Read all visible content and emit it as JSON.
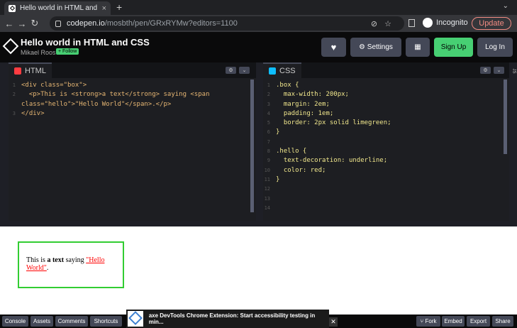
{
  "browser": {
    "tab_title": "Hello world in HTML and C",
    "tab_close": "×",
    "new_tab": "+",
    "tab_menu": "⌄",
    "url_host": "codepen.io",
    "url_path": "/mosbth/pen/GRxRYMw?editors=1100",
    "incognito_label": "Incognito",
    "update_label": "Update",
    "omni_icons": "⊘☆"
  },
  "header": {
    "title": "Hello world in HTML and CSS",
    "author": "Mikael Roos",
    "follow_label": "+ Follow",
    "heart": "♥",
    "settings_label": "⚙ Settings",
    "layout": "▦",
    "signup_label": "Sign Up",
    "login_label": "Log In"
  },
  "editors": {
    "html_tab": "HTML",
    "css_tab": "CSS",
    "ctrl_gear": "⚙",
    "ctrl_chevron": "⌄",
    "side_label": "JS"
  },
  "html_lines": [
    {
      "num": "1",
      "code": "<div class=\"box\">"
    },
    {
      "num": "2",
      "code": "  <p>This is <strong>a text</strong> saying <span"
    },
    {
      "num": "",
      "code": "class=\"hello\">\"Hello World\"</span>.</p>"
    },
    {
      "num": "3",
      "code": "</div>"
    }
  ],
  "css_lines": [
    {
      "num": "1",
      "code": ".box {"
    },
    {
      "num": "2",
      "code": "  max-width: 200px;"
    },
    {
      "num": "3",
      "code": "  margin: 2em;"
    },
    {
      "num": "4",
      "code": "  padding: 1em;"
    },
    {
      "num": "5",
      "code": "  border: 2px solid limegreen;"
    },
    {
      "num": "6",
      "code": "}"
    },
    {
      "num": "7",
      "code": ""
    },
    {
      "num": "8",
      "code": ".hello {"
    },
    {
      "num": "9",
      "code": "  text-decoration: underline;"
    },
    {
      "num": "10",
      "code": "  color: red;"
    },
    {
      "num": "11",
      "code": "}"
    },
    {
      "num": "12",
      "code": ""
    },
    {
      "num": "13",
      "code": ""
    },
    {
      "num": "14",
      "code": ""
    }
  ],
  "preview": {
    "text_before": "This is ",
    "strong": "a text",
    "text_mid": " saying ",
    "hello": "\"Hello World\"",
    "text_end": "."
  },
  "footer": {
    "console": "Console",
    "assets": "Assets",
    "comments": "Comments",
    "shortcuts": "Shortcuts",
    "fork": "⑂ Fork",
    "embed": "Embed",
    "export": "Export",
    "share": "Share",
    "axe_text": "axe DevTools Chrome Extension: Start accessibility testing in min...",
    "axe_close": "✕"
  }
}
